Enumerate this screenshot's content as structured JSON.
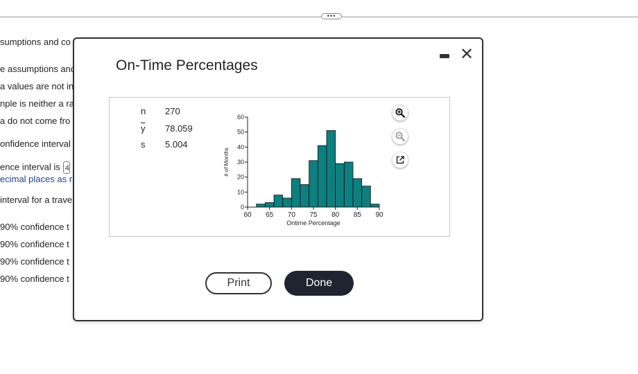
{
  "background": {
    "lines": [
      "sumptions and co",
      "e assumptions and",
      "a values are not in",
      "nple is neither a ra",
      "a do not come fro",
      "onfidence interval",
      "ence interval is",
      "ecimal places as r",
      "interval for a trave",
      "90% confidence t",
      "90% confidence t",
      "90% confidence t",
      "90% confidence t"
    ],
    "answer_box_value": "4"
  },
  "drag_handle": "•••",
  "dialog": {
    "title": "On-Time Percentages",
    "minimize_icon": "minimize-icon",
    "close_symbol": "✕",
    "stats": [
      {
        "label": "n",
        "value": "270"
      },
      {
        "label": "y",
        "value": "78.059"
      },
      {
        "label": "s",
        "value": "5.004"
      }
    ],
    "tools": [
      "zoom-in-icon",
      "zoom-out-icon",
      "external-link-icon"
    ],
    "print_label": "Print",
    "done_label": "Done"
  },
  "chart_data": {
    "type": "bar",
    "xlabel": "Ontime Percentage",
    "ylabel": "# of Months",
    "xlim": [
      60,
      90
    ],
    "ylim": [
      0,
      60
    ],
    "x_ticks": [
      60,
      65,
      70,
      75,
      80,
      85,
      90
    ],
    "y_ticks": [
      0,
      10,
      20,
      30,
      40,
      50,
      60
    ],
    "bin_width": 2,
    "bin_starts": [
      62,
      64,
      66,
      68,
      70,
      72,
      74,
      76,
      78,
      80,
      82,
      84,
      86,
      88
    ],
    "values": [
      2,
      3,
      8,
      6,
      19,
      15,
      31,
      41,
      51,
      29,
      30,
      19,
      14,
      2
    ],
    "bar_color": "#0e7f7f"
  }
}
